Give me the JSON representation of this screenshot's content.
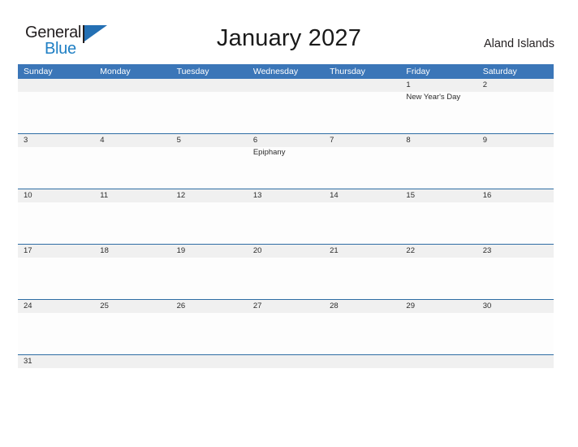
{
  "brand": {
    "name_part1": "General",
    "name_part2": "Blue",
    "flag_icon": "blue-flag-icon",
    "color_dark": "#231f20",
    "color_blue": "#1f7fc4"
  },
  "header": {
    "title": "January 2027",
    "locale": "Aland Islands"
  },
  "theme": {
    "header_blue": "#3b76b8",
    "rule_blue": "#2e6da4",
    "date_band_gray": "#f0f0f0"
  },
  "calendar": {
    "month": "January",
    "year": "2027",
    "weekday_headers": [
      "Sunday",
      "Monday",
      "Tuesday",
      "Wednesday",
      "Thursday",
      "Friday",
      "Saturday"
    ],
    "weeks": [
      {
        "days": [
          {
            "date": "",
            "event": ""
          },
          {
            "date": "",
            "event": ""
          },
          {
            "date": "",
            "event": ""
          },
          {
            "date": "",
            "event": ""
          },
          {
            "date": "",
            "event": ""
          },
          {
            "date": "1",
            "event": "New Year's Day"
          },
          {
            "date": "2",
            "event": ""
          }
        ]
      },
      {
        "days": [
          {
            "date": "3",
            "event": ""
          },
          {
            "date": "4",
            "event": ""
          },
          {
            "date": "5",
            "event": ""
          },
          {
            "date": "6",
            "event": "Epiphany"
          },
          {
            "date": "7",
            "event": ""
          },
          {
            "date": "8",
            "event": ""
          },
          {
            "date": "9",
            "event": ""
          }
        ]
      },
      {
        "days": [
          {
            "date": "10",
            "event": ""
          },
          {
            "date": "11",
            "event": ""
          },
          {
            "date": "12",
            "event": ""
          },
          {
            "date": "13",
            "event": ""
          },
          {
            "date": "14",
            "event": ""
          },
          {
            "date": "15",
            "event": ""
          },
          {
            "date": "16",
            "event": ""
          }
        ]
      },
      {
        "days": [
          {
            "date": "17",
            "event": ""
          },
          {
            "date": "18",
            "event": ""
          },
          {
            "date": "19",
            "event": ""
          },
          {
            "date": "20",
            "event": ""
          },
          {
            "date": "21",
            "event": ""
          },
          {
            "date": "22",
            "event": ""
          },
          {
            "date": "23",
            "event": ""
          }
        ]
      },
      {
        "days": [
          {
            "date": "24",
            "event": ""
          },
          {
            "date": "25",
            "event": ""
          },
          {
            "date": "26",
            "event": ""
          },
          {
            "date": "27",
            "event": ""
          },
          {
            "date": "28",
            "event": ""
          },
          {
            "date": "29",
            "event": ""
          },
          {
            "date": "30",
            "event": ""
          }
        ]
      },
      {
        "days": [
          {
            "date": "31",
            "event": ""
          },
          {
            "date": "",
            "event": ""
          },
          {
            "date": "",
            "event": ""
          },
          {
            "date": "",
            "event": ""
          },
          {
            "date": "",
            "event": ""
          },
          {
            "date": "",
            "event": ""
          },
          {
            "date": "",
            "event": ""
          }
        ]
      }
    ]
  }
}
